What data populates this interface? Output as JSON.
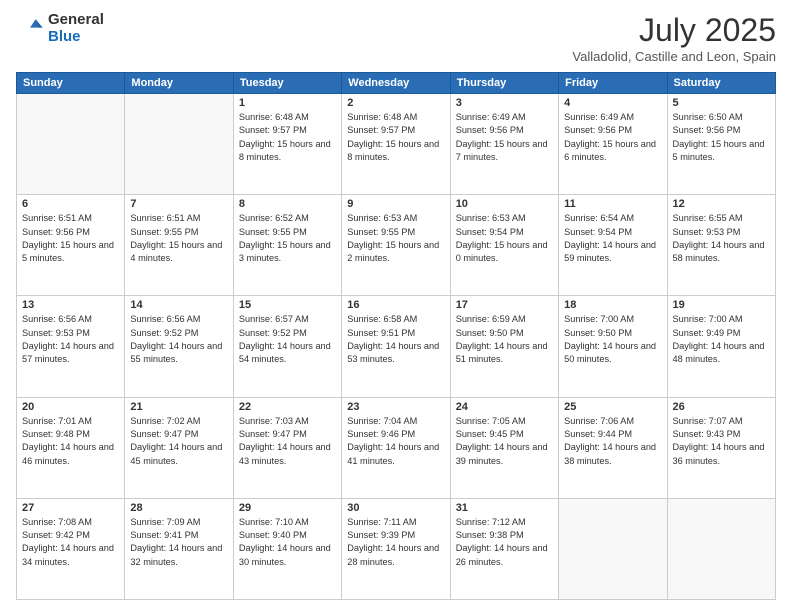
{
  "logo": {
    "general": "General",
    "blue": "Blue"
  },
  "header": {
    "month": "July 2025",
    "location": "Valladolid, Castille and Leon, Spain"
  },
  "weekdays": [
    "Sunday",
    "Monday",
    "Tuesday",
    "Wednesday",
    "Thursday",
    "Friday",
    "Saturday"
  ],
  "weeks": [
    [
      {
        "day": "",
        "info": ""
      },
      {
        "day": "",
        "info": ""
      },
      {
        "day": "1",
        "info": "Sunrise: 6:48 AM\nSunset: 9:57 PM\nDaylight: 15 hours and 8 minutes."
      },
      {
        "day": "2",
        "info": "Sunrise: 6:48 AM\nSunset: 9:57 PM\nDaylight: 15 hours and 8 minutes."
      },
      {
        "day": "3",
        "info": "Sunrise: 6:49 AM\nSunset: 9:56 PM\nDaylight: 15 hours and 7 minutes."
      },
      {
        "day": "4",
        "info": "Sunrise: 6:49 AM\nSunset: 9:56 PM\nDaylight: 15 hours and 6 minutes."
      },
      {
        "day": "5",
        "info": "Sunrise: 6:50 AM\nSunset: 9:56 PM\nDaylight: 15 hours and 5 minutes."
      }
    ],
    [
      {
        "day": "6",
        "info": "Sunrise: 6:51 AM\nSunset: 9:56 PM\nDaylight: 15 hours and 5 minutes."
      },
      {
        "day": "7",
        "info": "Sunrise: 6:51 AM\nSunset: 9:55 PM\nDaylight: 15 hours and 4 minutes."
      },
      {
        "day": "8",
        "info": "Sunrise: 6:52 AM\nSunset: 9:55 PM\nDaylight: 15 hours and 3 minutes."
      },
      {
        "day": "9",
        "info": "Sunrise: 6:53 AM\nSunset: 9:55 PM\nDaylight: 15 hours and 2 minutes."
      },
      {
        "day": "10",
        "info": "Sunrise: 6:53 AM\nSunset: 9:54 PM\nDaylight: 15 hours and 0 minutes."
      },
      {
        "day": "11",
        "info": "Sunrise: 6:54 AM\nSunset: 9:54 PM\nDaylight: 14 hours and 59 minutes."
      },
      {
        "day": "12",
        "info": "Sunrise: 6:55 AM\nSunset: 9:53 PM\nDaylight: 14 hours and 58 minutes."
      }
    ],
    [
      {
        "day": "13",
        "info": "Sunrise: 6:56 AM\nSunset: 9:53 PM\nDaylight: 14 hours and 57 minutes."
      },
      {
        "day": "14",
        "info": "Sunrise: 6:56 AM\nSunset: 9:52 PM\nDaylight: 14 hours and 55 minutes."
      },
      {
        "day": "15",
        "info": "Sunrise: 6:57 AM\nSunset: 9:52 PM\nDaylight: 14 hours and 54 minutes."
      },
      {
        "day": "16",
        "info": "Sunrise: 6:58 AM\nSunset: 9:51 PM\nDaylight: 14 hours and 53 minutes."
      },
      {
        "day": "17",
        "info": "Sunrise: 6:59 AM\nSunset: 9:50 PM\nDaylight: 14 hours and 51 minutes."
      },
      {
        "day": "18",
        "info": "Sunrise: 7:00 AM\nSunset: 9:50 PM\nDaylight: 14 hours and 50 minutes."
      },
      {
        "day": "19",
        "info": "Sunrise: 7:00 AM\nSunset: 9:49 PM\nDaylight: 14 hours and 48 minutes."
      }
    ],
    [
      {
        "day": "20",
        "info": "Sunrise: 7:01 AM\nSunset: 9:48 PM\nDaylight: 14 hours and 46 minutes."
      },
      {
        "day": "21",
        "info": "Sunrise: 7:02 AM\nSunset: 9:47 PM\nDaylight: 14 hours and 45 minutes."
      },
      {
        "day": "22",
        "info": "Sunrise: 7:03 AM\nSunset: 9:47 PM\nDaylight: 14 hours and 43 minutes."
      },
      {
        "day": "23",
        "info": "Sunrise: 7:04 AM\nSunset: 9:46 PM\nDaylight: 14 hours and 41 minutes."
      },
      {
        "day": "24",
        "info": "Sunrise: 7:05 AM\nSunset: 9:45 PM\nDaylight: 14 hours and 39 minutes."
      },
      {
        "day": "25",
        "info": "Sunrise: 7:06 AM\nSunset: 9:44 PM\nDaylight: 14 hours and 38 minutes."
      },
      {
        "day": "26",
        "info": "Sunrise: 7:07 AM\nSunset: 9:43 PM\nDaylight: 14 hours and 36 minutes."
      }
    ],
    [
      {
        "day": "27",
        "info": "Sunrise: 7:08 AM\nSunset: 9:42 PM\nDaylight: 14 hours and 34 minutes."
      },
      {
        "day": "28",
        "info": "Sunrise: 7:09 AM\nSunset: 9:41 PM\nDaylight: 14 hours and 32 minutes."
      },
      {
        "day": "29",
        "info": "Sunrise: 7:10 AM\nSunset: 9:40 PM\nDaylight: 14 hours and 30 minutes."
      },
      {
        "day": "30",
        "info": "Sunrise: 7:11 AM\nSunset: 9:39 PM\nDaylight: 14 hours and 28 minutes."
      },
      {
        "day": "31",
        "info": "Sunrise: 7:12 AM\nSunset: 9:38 PM\nDaylight: 14 hours and 26 minutes."
      },
      {
        "day": "",
        "info": ""
      },
      {
        "day": "",
        "info": ""
      }
    ]
  ]
}
